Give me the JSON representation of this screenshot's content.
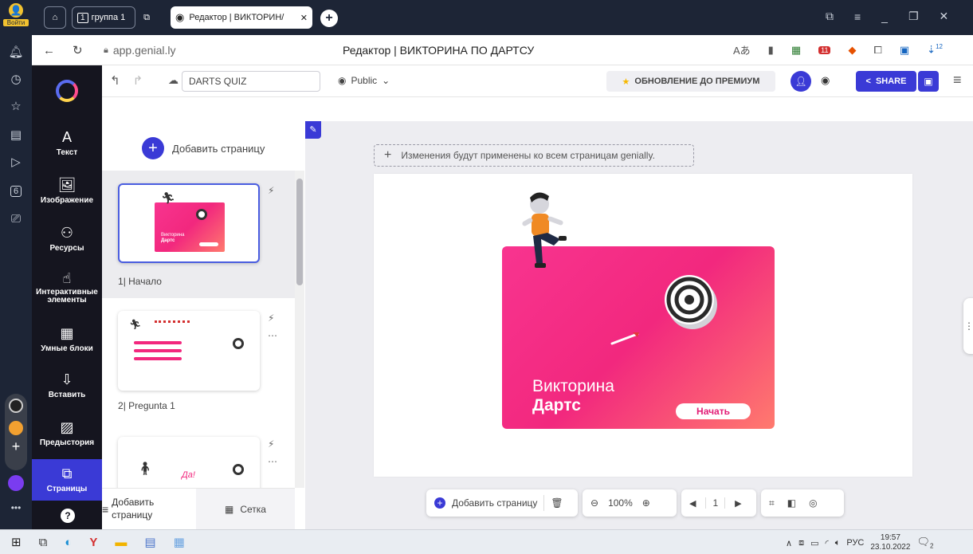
{
  "browser": {
    "login_label": "Войти",
    "tab_group_label": "группа 1",
    "tab_group_count": "1",
    "active_tab_title": "Редактор | ВИКТОРИН/",
    "url": "app.genial.ly",
    "page_title": "Редактор | ВИКТОРИНА ПО ДАРТСУ",
    "ext_badge_1": "11",
    "ext_badge_2": "12",
    "side_badge": "6"
  },
  "toolbar": {
    "doc_name": "DARTS QUIZ",
    "visibility": "Public",
    "upgrade_label": "ОБНОВЛЕНИЕ ДО ПРЕМИУМ",
    "share_label": "SHARE"
  },
  "sidebar": {
    "items": [
      {
        "label": "Текст",
        "icon": "A"
      },
      {
        "label": "Изображение",
        "icon": "🖼"
      },
      {
        "label": "Ресурсы",
        "icon": "⚇"
      },
      {
        "label": "Интерактивные элементы",
        "icon": "☝"
      },
      {
        "label": "Умные блоки",
        "icon": "▦"
      },
      {
        "label": "Вставить",
        "icon": "⇩"
      },
      {
        "label": "Предыстория",
        "icon": "▨"
      },
      {
        "label": "Страницы",
        "icon": "⧉"
      }
    ]
  },
  "pages": {
    "add_page_label": "Добавить страницу",
    "items": [
      {
        "number": "1",
        "name": "Начало"
      },
      {
        "number": "2",
        "name": "Pregunta 1"
      }
    ],
    "thumb1_title_line1": "Викторина",
    "thumb1_title_line2": "Дартс",
    "thumb3_text": "Да!",
    "bottom_add_label": "Добавить страницу",
    "grid_label": "Сетка"
  },
  "canvas": {
    "notice": "Изменения будут применены ко всем страницам genially.",
    "title_line1": "Викторина",
    "title_line2": "Дартс",
    "start_button": "Начать"
  },
  "bottom_bar": {
    "add_page_label": "Добавить страницу",
    "zoom": "100%",
    "page_number": "1"
  },
  "taskbar": {
    "lang": "РУС",
    "time": "19:57",
    "date": "23.10.2022",
    "notif_count": "2"
  },
  "colors": {
    "accent": "#3a3ad6",
    "brand_pink": "#f2287e",
    "app_dark": "#15151f",
    "browser_dark": "#1d2536"
  }
}
